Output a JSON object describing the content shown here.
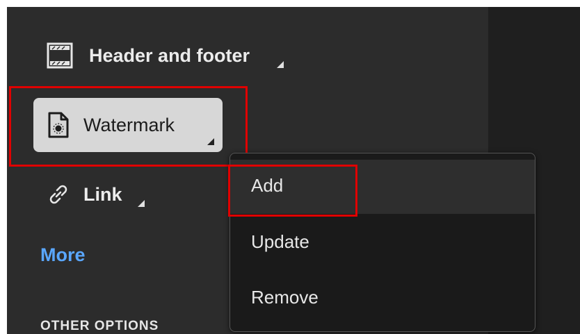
{
  "tools": {
    "header_footer": "Header and footer",
    "watermark": "Watermark",
    "link": "Link"
  },
  "more": "More",
  "other_options": "OTHER OPTIONS",
  "menu": {
    "items": [
      "Add",
      "Update",
      "Remove"
    ],
    "selected": "Add"
  },
  "colors": {
    "panel_bg": "#2c2c2c",
    "selected_button_bg": "#d7d7d7",
    "highlight_outline": "#e00000",
    "link_accent": "#5aa7ff"
  }
}
